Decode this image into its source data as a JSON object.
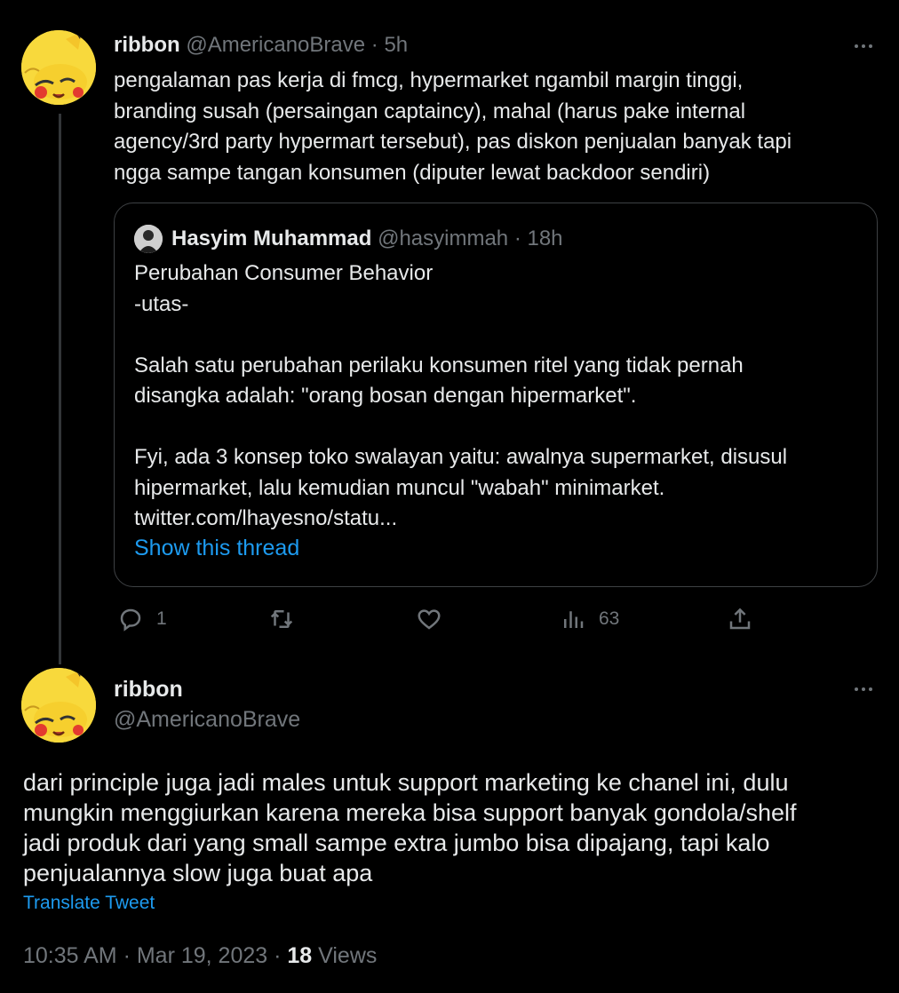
{
  "tweet1": {
    "name": "ribbon",
    "handle": "@AmericanoBrave",
    "time": "5h",
    "text_lines": [
      "pengalaman pas kerja di fmcg, hypermarket ngambil margin tinggi,",
      "branding susah (persaingan captaincy), mahal (harus pake internal",
      "agency/3rd party hypermart tersebut), pas diskon penjualan banyak tapi",
      "ngga sampe tangan konsumen (diputer lewat backdoor sendiri)"
    ],
    "quote": {
      "name": "Hasyim Muhammad",
      "handle": "@hasyimmah",
      "time": "18h",
      "para1": [
        "Perubahan Consumer Behavior",
        "-utas-"
      ],
      "para2": [
        "Salah satu perubahan perilaku konsumen ritel yang tidak pernah",
        "disangka adalah: \"orang bosan dengan hipermarket\"."
      ],
      "para3": [
        "Fyi, ada 3 konsep toko swalayan yaitu: awalnya supermarket, disusul",
        "hipermarket, lalu kemudian muncul \"wabah\" minimarket.",
        "twitter.com/lhayesno/statu..."
      ],
      "show_thread": "Show this thread"
    },
    "actions": {
      "reply_count": "1",
      "retweet_count": "",
      "like_count": "",
      "views_count": "63"
    }
  },
  "tweet2": {
    "name": "ribbon",
    "handle": "@AmericanoBrave",
    "text_lines": [
      "dari principle juga jadi males untuk support marketing ke chanel ini, dulu",
      "mungkin menggiurkan karena mereka bisa support banyak gondola/shelf",
      "jadi produk dari yang small sampe extra jumbo bisa dipajang, tapi kalo",
      "penjualannya slow juga buat apa"
    ],
    "translate": "Translate Tweet",
    "timestamp": "10:35 AM · Mar 19, 2023 · ",
    "views_count": "18",
    "views_label": " Views"
  },
  "colors": {
    "background": "#000000",
    "text": "#e7e9ea",
    "muted": "#71767b",
    "link": "#1d9bf0",
    "border": "#3e4144"
  }
}
